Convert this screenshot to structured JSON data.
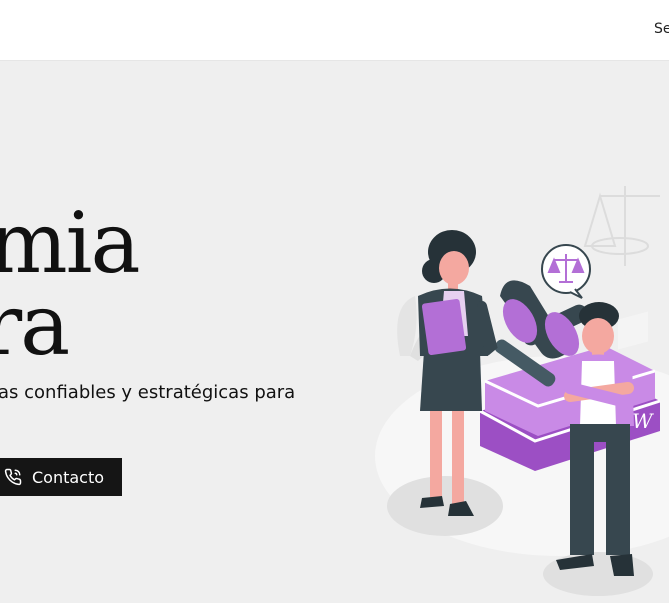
{
  "header": {
    "nav_partial": "Se"
  },
  "hero": {
    "title_line1": "mia",
    "title_line2": "ra",
    "tagline": "as confiables y estratégicas para",
    "contact_button": {
      "label": "Contacto",
      "icon": "phone-icon"
    }
  },
  "illustration": {
    "icon": "legal-team-illustration",
    "badge_icon": "scales-of-justice-icon",
    "book_letter": "W"
  },
  "colors": {
    "background": "#efefef",
    "accent": "#b36fd6",
    "dark": "#151515",
    "skin": "#f4a8a0",
    "suit": "#37474f"
  }
}
